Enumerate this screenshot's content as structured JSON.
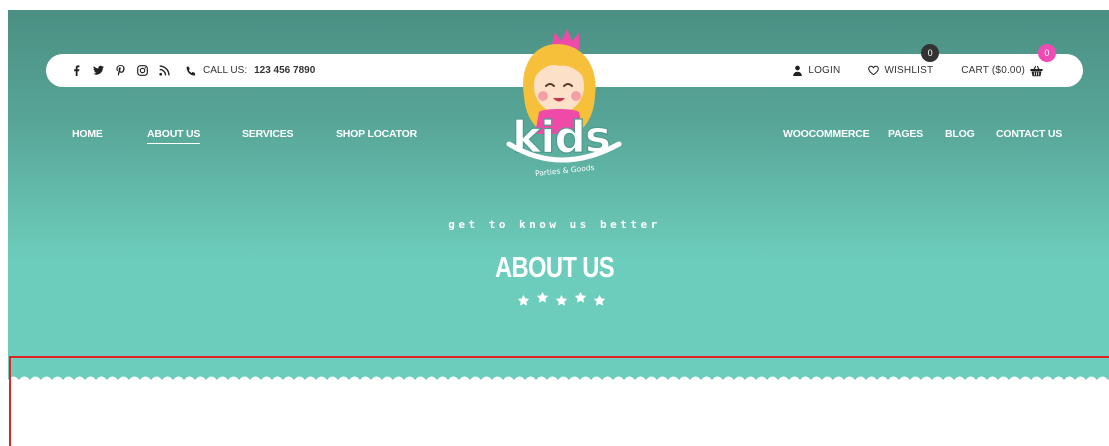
{
  "topbar": {
    "social_icons": [
      "facebook-icon",
      "twitter-icon",
      "pinterest-icon",
      "instagram-icon",
      "rss-icon"
    ],
    "call_label": "CALL US:",
    "call_number": "123 456 7890",
    "login_label": "LOGIN",
    "wishlist_label": "WISHLIST",
    "wishlist_count": "0",
    "cart_label": "CART ($0.00)",
    "cart_count": "0"
  },
  "nav": {
    "left": [
      "HOME",
      "ABOUT US",
      "SERVICES",
      "SHOP LOCATOR"
    ],
    "right": [
      "WOOCOMMERCE",
      "PAGES",
      "BLOG",
      "CONTACT US"
    ],
    "active": "ABOUT US"
  },
  "logo": {
    "word": "kids",
    "tagline": "Parties & Goods"
  },
  "hero": {
    "subtitle": "get to know us better",
    "title": "ABOUT US",
    "stars": 5
  },
  "colors": {
    "hero_top": "#4b8f82",
    "hero_bottom": "#6ccdbc",
    "wishlist_badge": "#333333",
    "cart_badge": "#f04bb4",
    "focus_frame": "#e02424"
  }
}
